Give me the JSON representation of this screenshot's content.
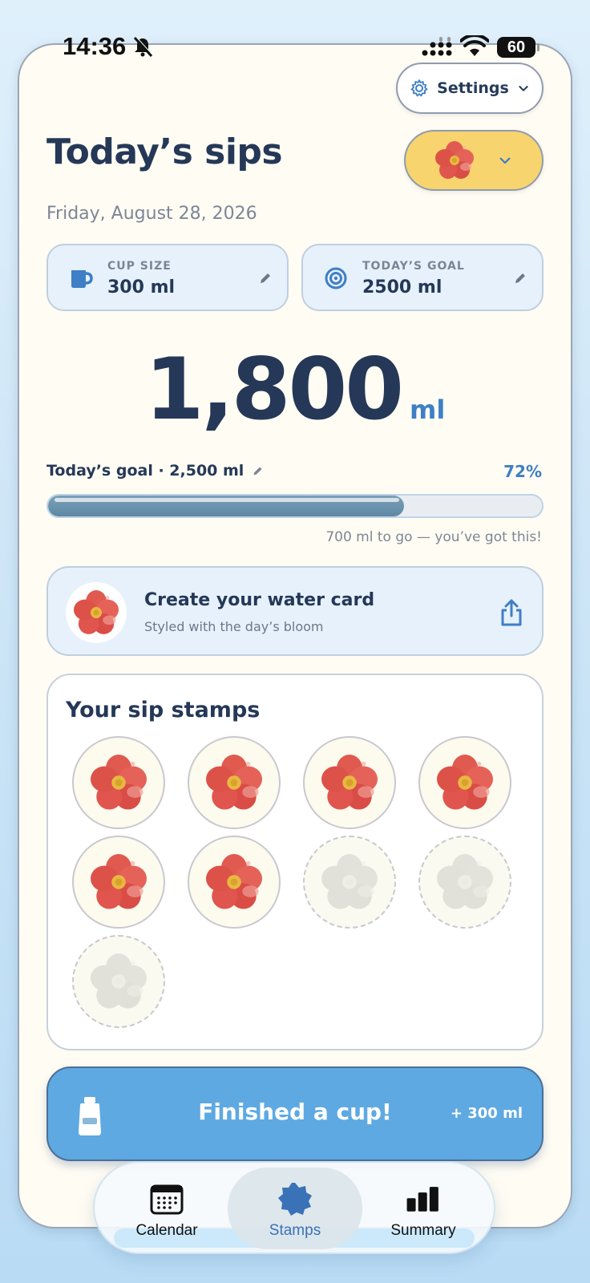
{
  "status_bar": {
    "time": "14:36",
    "battery": "60",
    "icons": [
      "bell-slash-icon",
      "signal-icon",
      "wifi-icon",
      "battery-icon"
    ]
  },
  "header": {
    "settings_label": "Settings",
    "title": "Today’s sips",
    "date": "Friday, August 28, 2026",
    "picker_color": "#f7d46d"
  },
  "stats": {
    "cup_size_label": "CUP SIZE",
    "cup_size_value": "300 ml",
    "goal_label": "TODAY’S GOAL",
    "goal_value": "2500 ml"
  },
  "total": {
    "number": "1,800",
    "unit": "ml"
  },
  "progress": {
    "label": "Today’s goal · 2,500 ml",
    "percent_text": "72%",
    "fraction": 0.72,
    "remaining_text": "700 ml to go — you’ve got this!"
  },
  "water_card": {
    "title": "Create your water card",
    "subtitle": "Styled with the day’s bloom"
  },
  "stamps": {
    "title": "Your sip stamps",
    "filled_count": 6,
    "total_count": 9
  },
  "finish_button": {
    "label": "Finished a cup!",
    "amount": "+ 300 ml"
  },
  "tabs": [
    {
      "label": "Calendar",
      "icon": "calendar-icon"
    },
    {
      "label": "Stamps",
      "icon": "stamp-badge-icon"
    },
    {
      "label": "Summary",
      "icon": "bar-chart-icon"
    }
  ],
  "colors": {
    "accent_blue": "#3e7fc6",
    "button_blue": "#5ea9e2",
    "navy_text": "#253857",
    "flower_red": "#e0534a"
  }
}
